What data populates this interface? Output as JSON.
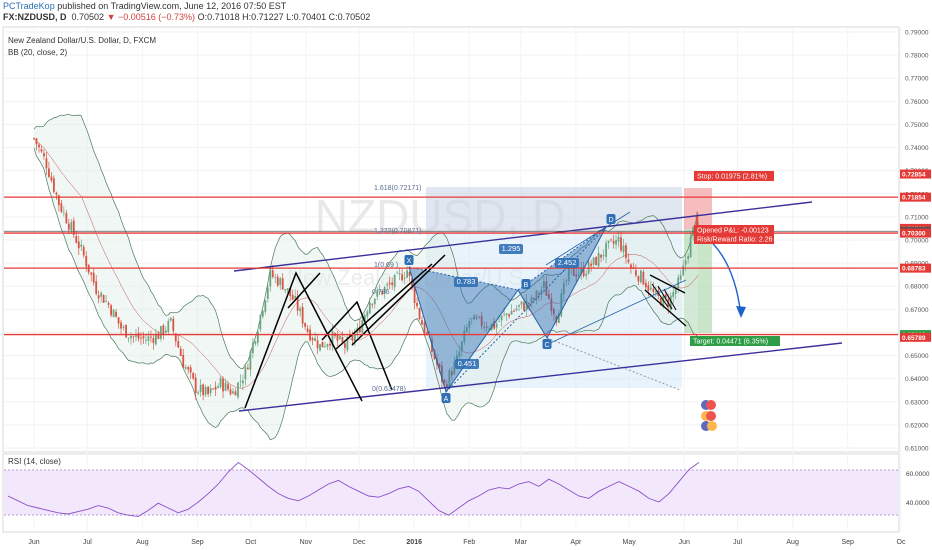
{
  "header": {
    "publisher": "PCTradeKop",
    "published_text": "published on TradingView.com, June 12, 2016 07:50 EST",
    "symbol": "FX:NZDUSD, D",
    "last": "0.70502",
    "change": "▼ −0.00516 (−0.73%)",
    "ohlc": "O:0.71018 H:0.71227 L:0.70401 C:0.70502"
  },
  "legend": {
    "instrument": "New Zealand Dollar/U.S. Dollar, D, FXCM",
    "bb": "BB (20, close, 2)",
    "watermark_symbol": "NZDUSD, D",
    "watermark_name": "New Zealand Dollar/U.S. Dollar"
  },
  "rsi": {
    "label": "RSI (14, close)",
    "ticks": [
      "60.0000",
      "40.0000"
    ]
  },
  "colors": {
    "up": "#6ba583",
    "down": "#d75442",
    "resistance": "#e53935",
    "channel": "#3a2f9c",
    "pattern": "#2f6fb5",
    "rsi": "#8a4fc9",
    "rsi_band": "#f3e8fb"
  },
  "chart_data": [
    {
      "type": "candlestick",
      "title": "New Zealand Dollar/U.S. Dollar, D, FXCM",
      "ylim": [
        0.61,
        0.79
      ],
      "y_ticks": [
        "0.79000",
        "0.78000",
        "0.77000",
        "0.76000",
        "0.75000",
        "0.74000",
        "0.73000",
        "0.72000",
        "0.71000",
        "0.70000",
        "0.69000",
        "0.68000",
        "0.67000",
        "0.66000",
        "0.65000",
        "0.64000",
        "0.63000",
        "0.62000",
        "0.61000"
      ],
      "x_ticks": [
        "Jun",
        "Jul",
        "Aug",
        "Sep",
        "Oct",
        "Nov",
        "Dec",
        "2016",
        "Feb",
        "Mar",
        "Apr",
        "May",
        "Jun",
        "Jul",
        "Aug",
        "Sep",
        "Oc"
      ],
      "close_path": [
        {
          "date": "2015-06-01",
          "close": 0.744
        },
        {
          "date": "2015-06-08",
          "close": 0.733
        },
        {
          "date": "2015-06-15",
          "close": 0.716
        },
        {
          "date": "2015-06-22",
          "close": 0.705
        },
        {
          "date": "2015-06-29",
          "close": 0.693
        },
        {
          "date": "2015-07-06",
          "close": 0.679
        },
        {
          "date": "2015-07-13",
          "close": 0.672
        },
        {
          "date": "2015-07-20",
          "close": 0.662
        },
        {
          "date": "2015-07-27",
          "close": 0.658
        },
        {
          "date": "2015-08-03",
          "close": 0.657
        },
        {
          "date": "2015-08-10",
          "close": 0.659
        },
        {
          "date": "2015-08-17",
          "close": 0.664
        },
        {
          "date": "2015-08-24",
          "close": 0.647
        },
        {
          "date": "2015-08-31",
          "close": 0.636
        },
        {
          "date": "2015-09-07",
          "close": 0.633
        },
        {
          "date": "2015-09-14",
          "close": 0.638
        },
        {
          "date": "2015-09-21",
          "close": 0.634
        },
        {
          "date": "2015-09-28",
          "close": 0.643
        },
        {
          "date": "2015-10-05",
          "close": 0.663
        },
        {
          "date": "2015-10-12",
          "close": 0.685
        },
        {
          "date": "2015-10-19",
          "close": 0.681
        },
        {
          "date": "2015-10-26",
          "close": 0.673
        },
        {
          "date": "2015-11-02",
          "close": 0.661
        },
        {
          "date": "2015-11-09",
          "close": 0.654
        },
        {
          "date": "2015-11-16",
          "close": 0.658
        },
        {
          "date": "2015-11-23",
          "close": 0.654
        },
        {
          "date": "2015-11-30",
          "close": 0.66
        },
        {
          "date": "2015-12-07",
          "close": 0.674
        },
        {
          "date": "2015-12-14",
          "close": 0.678
        },
        {
          "date": "2015-12-21",
          "close": 0.682
        },
        {
          "date": "2015-12-28",
          "close": 0.687
        },
        {
          "date": "2016-01-04",
          "close": 0.667
        },
        {
          "date": "2016-01-11",
          "close": 0.652
        },
        {
          "date": "2016-01-18",
          "close": 0.637
        },
        {
          "date": "2016-01-25",
          "close": 0.648
        },
        {
          "date": "2016-02-01",
          "close": 0.665
        },
        {
          "date": "2016-02-08",
          "close": 0.664
        },
        {
          "date": "2016-02-15",
          "close": 0.663
        },
        {
          "date": "2016-02-22",
          "close": 0.668
        },
        {
          "date": "2016-02-29",
          "close": 0.671
        },
        {
          "date": "2016-03-07",
          "close": 0.673
        },
        {
          "date": "2016-03-14",
          "close": 0.68
        },
        {
          "date": "2016-03-21",
          "close": 0.667
        },
        {
          "date": "2016-03-28",
          "close": 0.686
        },
        {
          "date": "2016-04-04",
          "close": 0.686
        },
        {
          "date": "2016-04-11",
          "close": 0.69
        },
        {
          "date": "2016-04-18",
          "close": 0.696
        },
        {
          "date": "2016-04-25",
          "close": 0.7
        },
        {
          "date": "2016-05-02",
          "close": 0.688
        },
        {
          "date": "2016-05-09",
          "close": 0.683
        },
        {
          "date": "2016-05-16",
          "close": 0.675
        },
        {
          "date": "2016-05-23",
          "close": 0.673
        },
        {
          "date": "2016-05-30",
          "close": 0.683
        },
        {
          "date": "2016-06-06",
          "close": 0.704
        },
        {
          "date": "2016-06-10",
          "close": 0.70502
        }
      ],
      "last_candle": {
        "open": 0.71018,
        "high": 0.71227,
        "low": 0.70401,
        "close": 0.70502
      },
      "price_labels": [
        {
          "text": "0.72854",
          "value": 0.72854,
          "color": "#e53935"
        },
        {
          "text": "0.71854",
          "value": 0.71854,
          "color": "#e53935"
        },
        {
          "text": "0.70502",
          "value": 0.70502,
          "color": "#e53935"
        },
        {
          "text": "0.70379",
          "value": 0.70379,
          "color": "#555555"
        },
        {
          "text": "0.70300",
          "value": 0.703,
          "color": "#e53935"
        },
        {
          "text": "0.68783",
          "value": 0.68783,
          "color": "#e53935"
        },
        {
          "text": "0.65908",
          "value": 0.65908,
          "color": "#2e9e46"
        },
        {
          "text": "0.65789",
          "value": 0.65789,
          "color": "#e53935"
        }
      ],
      "horizontal_levels": [
        0.71854,
        0.70379,
        0.703,
        0.68783,
        0.65908
      ],
      "annotations": {
        "pattern_points": [
          "X",
          "A",
          "B",
          "C",
          "D"
        ],
        "ratios": [
          "1.295",
          "0.783",
          "2.452",
          "0.451"
        ],
        "fib_labels": [
          "1.618(0.72171)",
          "1.272(0.70871)",
          "1(0.69 )",
          "0.786",
          "0(0.63478)"
        ],
        "stop": "Stop: 0.01975 (2.81%)",
        "opened_pl": "Opened P&L: -0.00123",
        "risk_reward": "Risk/Reward Ratio: 2.26",
        "target": "Target: 0.04471 (6.35%)"
      }
    },
    {
      "type": "line",
      "title": "RSI (14, close)",
      "ylim": [
        20,
        85
      ],
      "bands": [
        30,
        70
      ],
      "series": [
        {
          "values": [
            50,
            46,
            42,
            40,
            38,
            36,
            35,
            37,
            39,
            42,
            40,
            36,
            34,
            33,
            38,
            44,
            40,
            36,
            39,
            45,
            52,
            60,
            70,
            78,
            72,
            65,
            58,
            52,
            48,
            46,
            50,
            55,
            60,
            63,
            58,
            54,
            50,
            49,
            52,
            56,
            58,
            54,
            46,
            38,
            34,
            40,
            46,
            50,
            55,
            57,
            56,
            60,
            62,
            58,
            64,
            60,
            55,
            50,
            48,
            54,
            58,
            62,
            58,
            54,
            48,
            45,
            52,
            62,
            72,
            78
          ]
        }
      ]
    }
  ]
}
